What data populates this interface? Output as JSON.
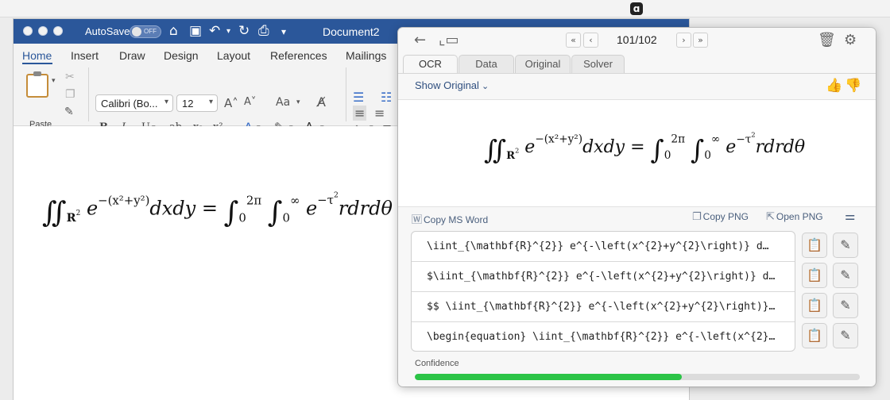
{
  "menubar": {
    "app_icon": "mathpix-logo-icon"
  },
  "word": {
    "autosave_label": "AutoSave",
    "autosave_state": "OFF",
    "doc_title": "Document2",
    "tabs": [
      {
        "label": "Home",
        "active": true
      },
      {
        "label": "Insert"
      },
      {
        "label": "Draw"
      },
      {
        "label": "Design"
      },
      {
        "label": "Layout"
      },
      {
        "label": "References"
      },
      {
        "label": "Mailings"
      }
    ],
    "font_name": "Calibri (Bo...",
    "font_size": "12",
    "paste_label": "Paste",
    "format_buttons": [
      "B",
      "I",
      "U",
      "ab",
      "x₂",
      "x²"
    ],
    "grow_font": "A˄",
    "shrink_font": "A˅",
    "change_case": "Aa",
    "accent_color": "#2b579a"
  },
  "equation": {
    "domain": "R",
    "domain_exp": "2",
    "e": "e",
    "exponent": "−(x²+y²)",
    "dxdy": "dxdy",
    "equals": "=",
    "lower1": "0",
    "upper1": "2π",
    "lower2": "0",
    "upper2": "∞",
    "tau_exp": "−τ",
    "tau_exp_sup": "2",
    "rdrd": "rdrdθ"
  },
  "panel": {
    "page_indicator": "101/102",
    "tabs": [
      {
        "label": "OCR",
        "active": true
      },
      {
        "label": "Data"
      },
      {
        "label": "Original"
      },
      {
        "label": "Solver"
      }
    ],
    "show_original": "Show Original",
    "actions": {
      "copy_ms_word": "Copy MS Word",
      "copy_png": "Copy PNG",
      "open_png": "Open PNG"
    },
    "code_rows": [
      "\\iint_{\\mathbf{R}^{2}} e^{-\\left(x^{2}+y^{2}\\right)} d…",
      "$\\iint_{\\mathbf{R}^{2}} e^{-\\left(x^{2}+y^{2}\\right)} d…",
      "$$ \\iint_{\\mathbf{R}^{2}} e^{-\\left(x^{2}+y^{2}\\right)}…",
      "\\begin{equation} \\iint_{\\mathbf{R}^{2}} e^{-\\left(x^{2}…"
    ],
    "confidence_label": "Confidence",
    "confidence": 0.6,
    "confidence_color": "#2cc447"
  }
}
